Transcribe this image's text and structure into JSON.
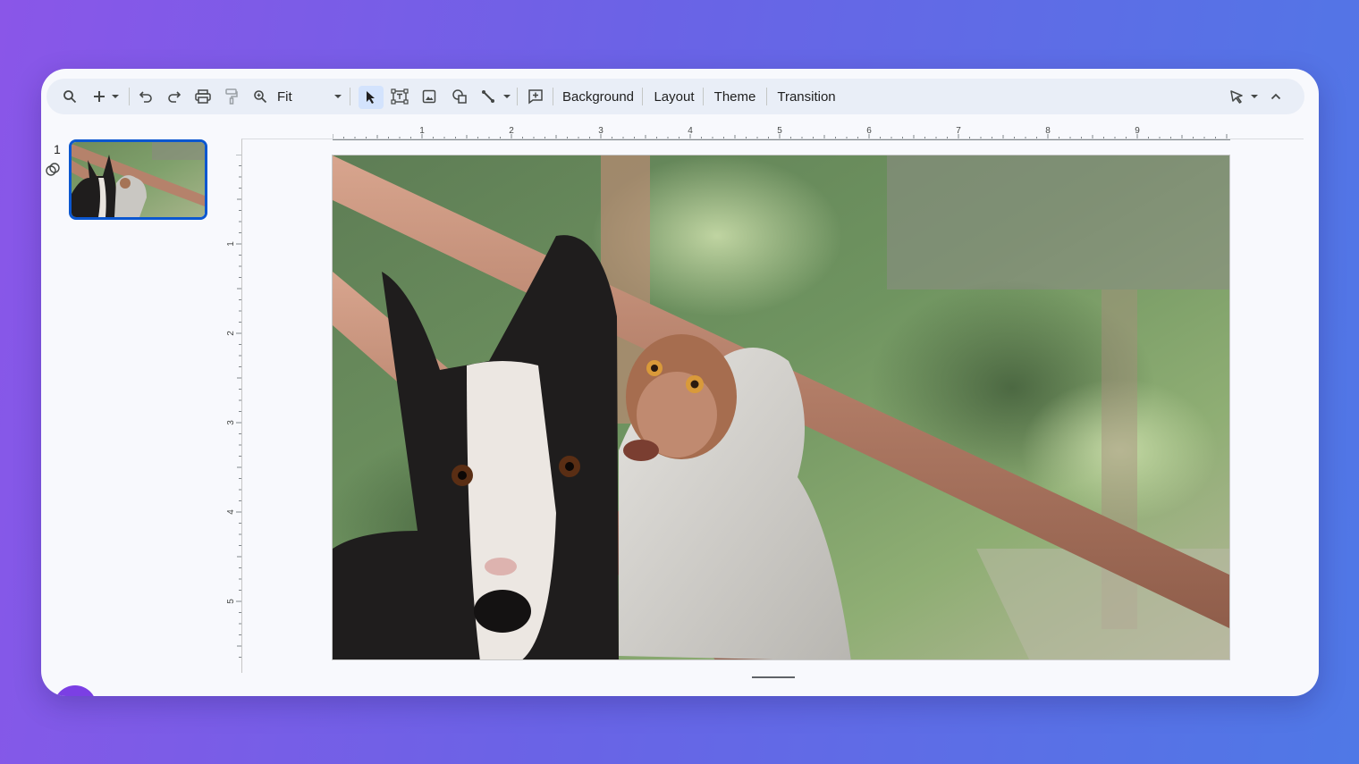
{
  "toolbar": {
    "zoom_value": "Fit",
    "background_label": "Background",
    "layout_label": "Layout",
    "theme_label": "Theme",
    "transition_label": "Transition",
    "icons": [
      "search-icon",
      "add-icon",
      "undo-icon",
      "redo-icon",
      "print-icon",
      "paint-format-icon",
      "zoom-icon",
      "select-icon",
      "text-box-icon",
      "image-icon",
      "shape-icon",
      "line-icon",
      "comment-icon",
      "pen-icon",
      "collapse-icon"
    ]
  },
  "filmstrip": {
    "slides": [
      {
        "number": "1"
      }
    ]
  },
  "rulers": {
    "horizontal": [
      "1",
      "2",
      "3",
      "4",
      "5",
      "6",
      "7",
      "8",
      "9"
    ],
    "vertical": [
      "1",
      "2",
      "3",
      "4",
      "5"
    ]
  },
  "colors": {
    "accent": "#0b57d0",
    "selected_tool_bg": "#d3e3fd",
    "toolbar_bg": "#e9eef7"
  }
}
